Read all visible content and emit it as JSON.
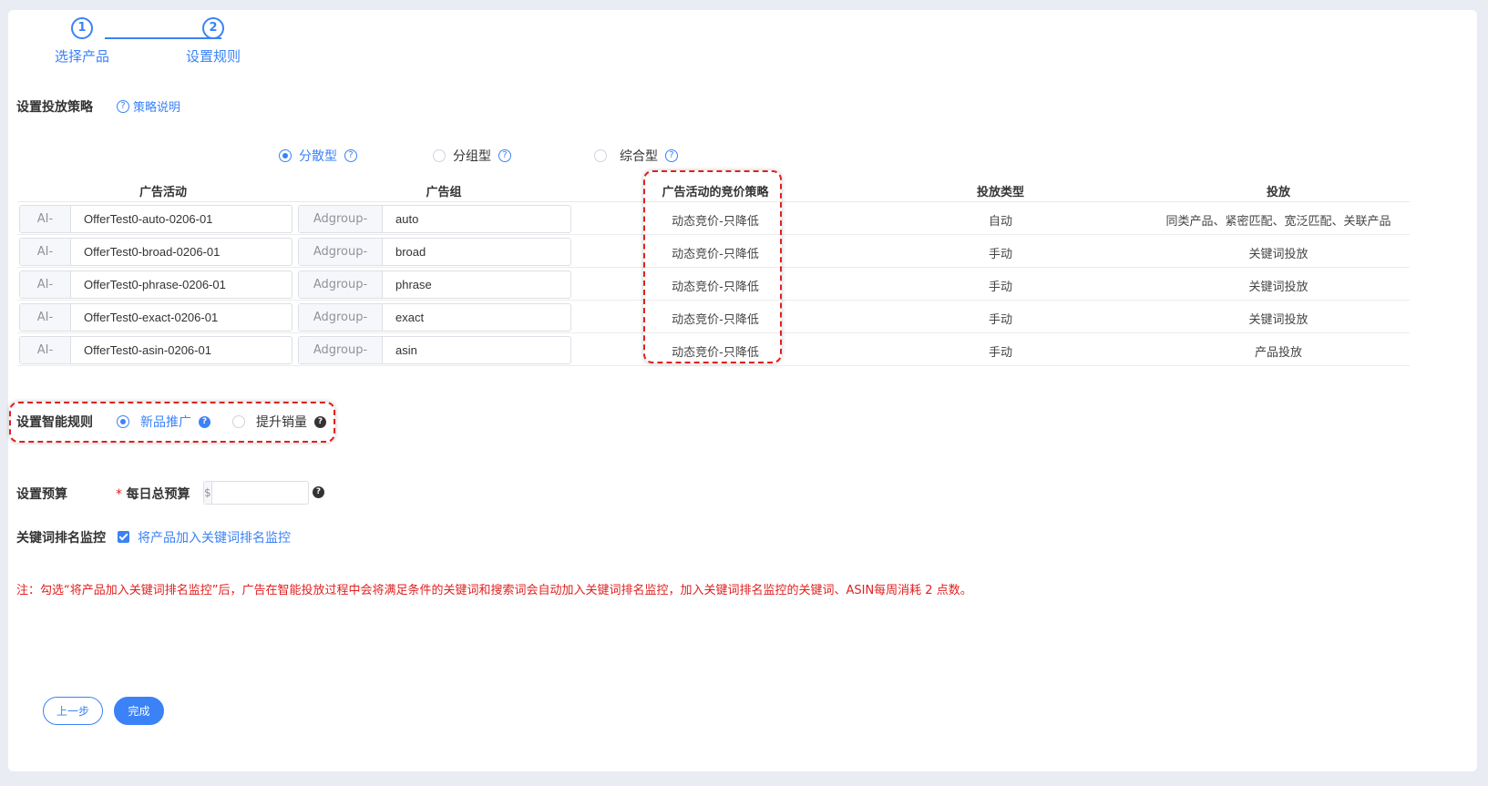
{
  "steps": [
    {
      "number": "1",
      "label": "选择产品"
    },
    {
      "number": "2",
      "label": "设置规则"
    }
  ],
  "strategy": {
    "label": "设置投放策略",
    "help_link": "策略说明",
    "options": [
      {
        "label": "分散型",
        "checked": true
      },
      {
        "label": "分组型",
        "checked": false
      },
      {
        "label": "综合型",
        "checked": false
      }
    ]
  },
  "table": {
    "headers": {
      "campaign": "广告活动",
      "adgroup": "广告组",
      "bid_strategy": "广告活动的竞价策略",
      "targeting_type": "投放类型",
      "targeting": "投放"
    },
    "rows": [
      {
        "campaign_prefix": "AI-",
        "campaign": "OfferTest0-auto-0206-01",
        "adgroup_prefix": "Adgroup-",
        "adgroup": "auto",
        "bid_strategy": "动态竞价-只降低",
        "targeting_type": "自动",
        "targeting": "同类产品、紧密匹配、宽泛匹配、关联产品"
      },
      {
        "campaign_prefix": "AI-",
        "campaign": "OfferTest0-broad-0206-01",
        "adgroup_prefix": "Adgroup-",
        "adgroup": "broad",
        "bid_strategy": "动态竞价-只降低",
        "targeting_type": "手动",
        "targeting": "关键词投放"
      },
      {
        "campaign_prefix": "AI-",
        "campaign": "OfferTest0-phrase-0206-01",
        "adgroup_prefix": "Adgroup-",
        "adgroup": "phrase",
        "bid_strategy": "动态竞价-只降低",
        "targeting_type": "手动",
        "targeting": "关键词投放"
      },
      {
        "campaign_prefix": "AI-",
        "campaign": "OfferTest0-exact-0206-01",
        "adgroup_prefix": "Adgroup-",
        "adgroup": "exact",
        "bid_strategy": "动态竞价-只降低",
        "targeting_type": "手动",
        "targeting": "关键词投放"
      },
      {
        "campaign_prefix": "AI-",
        "campaign": "OfferTest0-asin-0206-01",
        "adgroup_prefix": "Adgroup-",
        "adgroup": "asin",
        "bid_strategy": "动态竞价-只降低",
        "targeting_type": "手动",
        "targeting": "产品投放"
      }
    ]
  },
  "smart_rules": {
    "label": "设置智能规则",
    "options": [
      {
        "label": "新品推广",
        "checked": true
      },
      {
        "label": "提升销量",
        "checked": false
      }
    ]
  },
  "budget": {
    "label": "设置预算",
    "required_mark": "*",
    "field_label": "每日总预算",
    "currency": "$",
    "value": ""
  },
  "keyword_monitor": {
    "label": "关键词排名监控",
    "checkbox_label": "将产品加入关键词排名监控",
    "checked": true
  },
  "note": "注：勾选“将产品加入关键词排名监控”后，广告在智能投放过程中会将满足条件的关键词和搜索词会自动加入关键词排名监控，加入关键词排名监控的关键词、ASIN每周消耗 2 点数。",
  "buttons": {
    "prev": "上一步",
    "done": "完成"
  },
  "colors": {
    "accent": "#3b82f6",
    "highlight": "#e02020",
    "note": "#e02020"
  }
}
